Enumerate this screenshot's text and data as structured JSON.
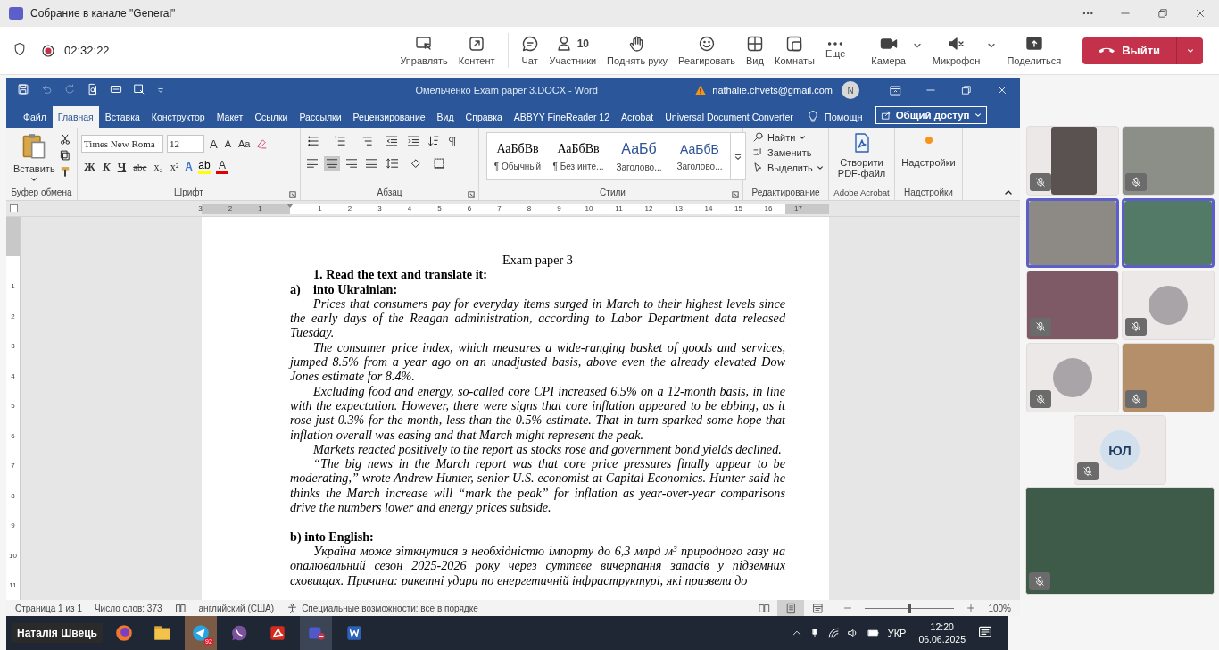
{
  "teams": {
    "title": "Собрание в канале \"General\"",
    "recording": true,
    "timer": "02:32:22",
    "toolbar_groups": [
      {
        "items": [
          {
            "kind": "manage",
            "label": "Управлять"
          },
          {
            "kind": "content",
            "label": "Контент"
          }
        ]
      },
      {
        "items": [
          {
            "kind": "chat",
            "label": "Чат"
          },
          {
            "kind": "people",
            "label": "Участники",
            "count": "10"
          },
          {
            "kind": "hand",
            "label": "Поднять руку"
          },
          {
            "kind": "react",
            "label": "Реагировать"
          },
          {
            "kind": "view",
            "label": "Вид"
          },
          {
            "kind": "rooms",
            "label": "Комнаты"
          },
          {
            "kind": "more",
            "label": "Еще"
          }
        ]
      },
      {
        "items": [
          {
            "kind": "camera",
            "label": "Камера",
            "dropdown": true
          },
          {
            "kind": "mic",
            "label": "Микрофон",
            "dropdown": true,
            "muted": true
          },
          {
            "kind": "share",
            "label": "Поделиться"
          }
        ]
      }
    ],
    "leave": {
      "label": "Выйти"
    }
  },
  "word": {
    "title": "Омельченко Exam paper 3.DOCX  -  Word",
    "account": "nathalie.chvets@gmail.com",
    "avatar": "N",
    "tabs": [
      {
        "label": "Файл",
        "selected": false
      },
      {
        "label": "Главная",
        "selected": true
      },
      {
        "label": "Вставка",
        "selected": false
      },
      {
        "label": "Конструктор",
        "selected": false
      },
      {
        "label": "Макет",
        "selected": false
      },
      {
        "label": "Ссылки",
        "selected": false
      },
      {
        "label": "Рассылки",
        "selected": false
      },
      {
        "label": "Рецензирование",
        "selected": false
      },
      {
        "label": "Вид",
        "selected": false
      },
      {
        "label": "Справка",
        "selected": false
      },
      {
        "label": "ABBYY FineReader 12",
        "selected": false
      },
      {
        "label": "Acrobat",
        "selected": false
      },
      {
        "label": "Universal Document Converter",
        "selected": false
      }
    ],
    "tell_me": "Помощн",
    "share": "Общий доступ",
    "ribbon": {
      "clipboard": {
        "label": "Буфер обмена",
        "paste": "Вставить"
      },
      "font": {
        "label": "Шрифт",
        "font_name": "Times New Roma",
        "font_size": "12",
        "size_buttons": [
          "A",
          "A"
        ],
        "case_button": "Aa",
        "format_buttons": [
          {
            "kind": "bold",
            "label": "Ж"
          },
          {
            "kind": "italic",
            "label": "К"
          },
          {
            "kind": "underline",
            "label": "Ч"
          },
          {
            "kind": "strike",
            "label": "abc"
          },
          {
            "kind": "sub",
            "label": "x₂"
          },
          {
            "kind": "sup",
            "label": "x²"
          }
        ],
        "color_buttons": [
          {
            "kind": "effects",
            "label": "A"
          },
          {
            "kind": "highlight",
            "label": "ab"
          },
          {
            "kind": "color",
            "label": "A"
          }
        ]
      },
      "paragraph": {
        "label": "Абзац",
        "alignments": [
          {
            "selected": false
          },
          {
            "selected": true
          },
          {
            "selected": false
          },
          {
            "selected": false
          }
        ]
      },
      "styles": {
        "label": "Стили",
        "items": [
          {
            "kind": "normal",
            "sample": "АаБбВв",
            "name": "¶ Обычный"
          },
          {
            "kind": "normal",
            "sample": "АаБбВв",
            "name": "¶ Без инте..."
          },
          {
            "kind": "heading",
            "sample": "АаБб",
            "name": "Заголово..."
          },
          {
            "kind": "heading2",
            "sample": "АаБбВ",
            "name": "Заголово..."
          }
        ]
      },
      "editing": {
        "label": "Редактирование",
        "items": [
          {
            "kind": "find",
            "label": "Найти",
            "dropdown": true
          },
          {
            "kind": "replace",
            "label": "Заменить",
            "dropdown": false
          },
          {
            "kind": "select",
            "label": "Выделить",
            "dropdown": true
          }
        ]
      },
      "acrobat": {
        "label": "Adobe Acrobat",
        "button": "Створити PDF-файл"
      },
      "addins": {
        "label": "Надстройки",
        "button": "Надстройки"
      }
    },
    "ruler": {
      "left_labels": [
        "3",
        "2",
        "1"
      ],
      "right_labels": [
        "1",
        "2",
        "3",
        "4",
        "5",
        "6",
        "7",
        "8",
        "9",
        "10",
        "11",
        "12",
        "13",
        "14",
        "15",
        "16",
        "17"
      ]
    },
    "vertical_ruler": [
      "1",
      "2",
      "3",
      "4",
      "5",
      "6",
      "7",
      "8",
      "9",
      "10",
      "11"
    ],
    "document": [
      {
        "kind": "title",
        "text": "Exam paper 3"
      },
      {
        "kind": "heading",
        "text": "1. Read the text and translate it:"
      },
      {
        "kind": "list-heading",
        "marker": "a)",
        "text": "into Ukrainian:"
      },
      {
        "kind": "paragraph",
        "text": "Prices that consumers pay for everyday items surged in March to their highest levels since the early days of the Reagan administration, according to Labor Department data released Tuesday."
      },
      {
        "kind": "paragraph",
        "text": "The consumer price index, which measures a wide-ranging basket of goods and services, jumped 8.5% from a year ago on an unadjusted basis, above even the already elevated Dow Jones estimate for 8.4%."
      },
      {
        "kind": "paragraph",
        "text": "Excluding food and energy, so-called core CPI increased 6.5% on a 12-month basis, in line with the expectation. However, there were signs that core inflation appeared to be ebbing, as it rose just 0.3% for the month, less than the 0.5% estimate. That in turn sparked some hope that inflation overall was easing and that March might represent the peak."
      },
      {
        "kind": "paragraph",
        "text": "Markets reacted positively to the report as stocks rose and government bond yields declined."
      },
      {
        "kind": "paragraph",
        "text": "“The big news in the March report was that core price pressures finally appear to be moderating,” wrote Andrew Hunter, senior U.S. economist at Capital Economics. Hunter said he thinks the March increase will “mark the peak” for inflation as year-over-year comparisons drive the numbers lower and energy prices subside."
      },
      {
        "kind": "subheading",
        "text": "b) into English:"
      },
      {
        "kind": "paragraph",
        "text": "Україна може зіткнутися з необхідністю імпорту до 6,3 млрд м³ природного газу на опалювальний сезон 2025-2026 року через суттєве вичерпання запасів у підземних сховищах. Причина: ракетні удари по енергетичній інфраструктурі, які призвели до"
      }
    ],
    "status": {
      "page": "Страница 1 из 1",
      "words": "Число слов: 373",
      "language": "английский (США)",
      "accessibility": "Специальные возможности: все в порядке",
      "views": [
        {
          "kind": "read",
          "selected": false
        },
        {
          "kind": "print",
          "selected": true
        },
        {
          "kind": "web",
          "selected": false
        }
      ],
      "zoom": {
        "level": 0.5,
        "reading": "100%"
      }
    }
  },
  "taskbar": {
    "presenter": "Наталія Швець",
    "apps": [
      {
        "kind": "firefox",
        "active": false,
        "flashing": false
      },
      {
        "kind": "explorer",
        "active": false,
        "flashing": false
      },
      {
        "kind": "telegram",
        "active": false,
        "flashing": true,
        "badge": "92"
      },
      {
        "kind": "viber",
        "active": false,
        "flashing": false
      },
      {
        "kind": "acrobat",
        "active": false,
        "flashing": false
      },
      {
        "kind": "teams",
        "active": true,
        "flashing": false
      },
      {
        "kind": "word",
        "active": false,
        "flashing": false
      }
    ],
    "language": "УКР",
    "time": "12:20",
    "date": "06.06.2025"
  },
  "video_rows": [
    [
      {
        "kind": "video",
        "muted": true,
        "highlighted": false
      },
      {
        "kind": "video",
        "muted": true,
        "highlighted": false
      }
    ],
    [
      {
        "kind": "video",
        "muted": false,
        "highlighted": true
      },
      {
        "kind": "video",
        "muted": false,
        "highlighted": true
      }
    ],
    [
      {
        "kind": "video",
        "muted": true,
        "highlighted": false
      },
      {
        "kind": "photo-avatar",
        "muted": true,
        "highlighted": false
      }
    ],
    [
      {
        "kind": "photo-avatar",
        "muted": true,
        "highlighted": false
      },
      {
        "kind": "video",
        "muted": true,
        "highlighted": false
      }
    ],
    [
      {
        "kind": "initials",
        "initials": "ЮЛ",
        "muted": true,
        "highlighted": false
      }
    ],
    [
      {
        "kind": "spotlight",
        "muted": true,
        "highlighted": false
      }
    ]
  ]
}
